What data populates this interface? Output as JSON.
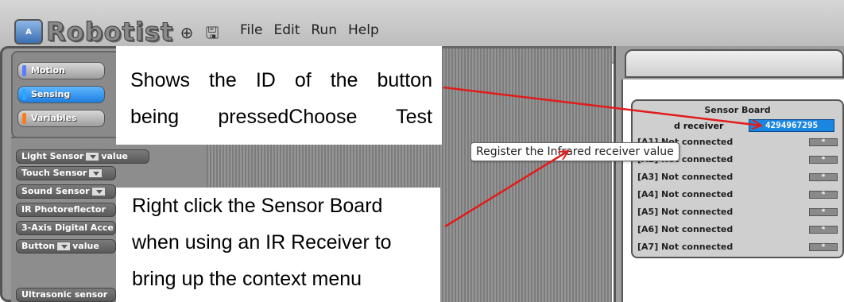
{
  "app": {
    "logo_badge": "A",
    "logo_text": "Robotist"
  },
  "toolbar": {
    "globe_icon": "globe-icon",
    "save_icon": "save-icon"
  },
  "menu": [
    "File",
    "Edit",
    "Run",
    "Help"
  ],
  "categories": [
    {
      "label": "Motion",
      "color": "#5a7cff",
      "active": false
    },
    {
      "label": "Sensing",
      "color": "#2aa7ff",
      "active": true
    },
    {
      "label": "Variables",
      "color": "#ff7a1a",
      "active": false
    }
  ],
  "blocks": [
    {
      "label": "Light Sensor",
      "suffix": "value"
    },
    {
      "label": "Touch Sensor",
      "suffix": ""
    },
    {
      "label": "Sound Sensor",
      "suffix": ""
    },
    {
      "label": "IR Photoreflector",
      "suffix": ""
    },
    {
      "label": "3-Axis Digital Acce",
      "suffix": ""
    },
    {
      "label": "Button",
      "suffix": "value"
    },
    {
      "label": "Ultrasonic sensor",
      "suffix": ""
    }
  ],
  "sensor_board": {
    "title": "Sensor Board",
    "ir_label": "d receiver",
    "ir_value": "4294967295",
    "rows": [
      {
        "label": "[A1] Not connected"
      },
      {
        "label": "[A2] Not connected"
      },
      {
        "label": "[A3] Not connected"
      },
      {
        "label": "[A4] Not connected"
      },
      {
        "label": "[A5] Not connected"
      },
      {
        "label": "[A6] Not connected"
      },
      {
        "label": "[A7] Not connected"
      }
    ]
  },
  "tooltip": "Register the Infrared receiver value",
  "annotations": {
    "top_lines": [
      "Shows the ID of the button",
      "being pressedChoose Test"
    ],
    "bottom_lines": [
      "Right click the Sensor Board",
      "when using an IR Receiver to",
      "bring up the context menu"
    ]
  },
  "colors": {
    "arrow": "#e21b1b",
    "ir_value_bg": "#1b86e0"
  }
}
